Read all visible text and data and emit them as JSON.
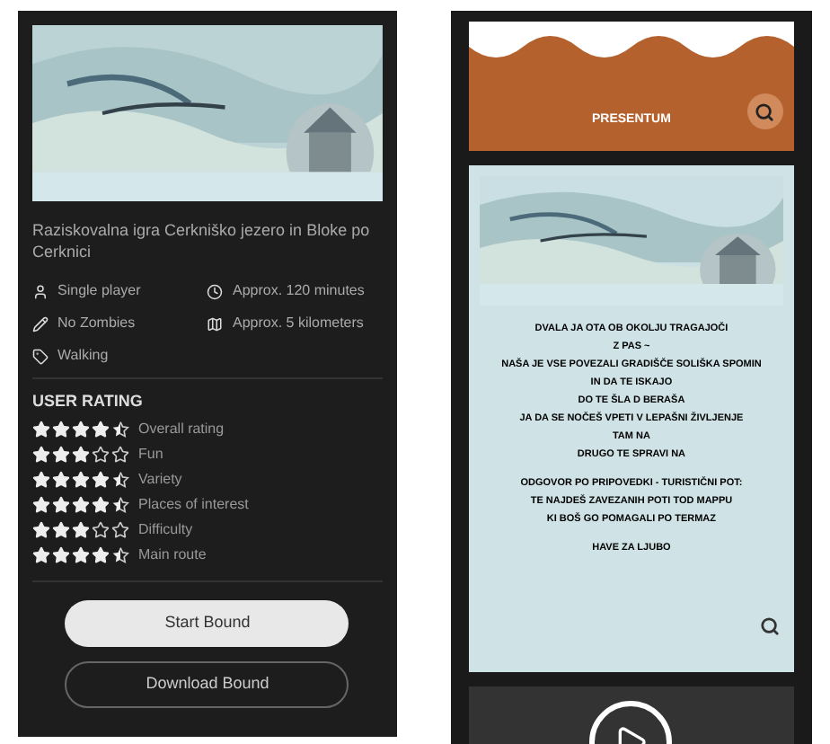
{
  "left_panel": {
    "banner": {
      "kind": "picture"
    },
    "description": "Raziskovalna igra Cerkniško jezero in Bloke po Cerknici",
    "details": [
      {
        "kind": "person",
        "text": "Single player"
      },
      {
        "kind": "clock",
        "text": "Approx. 120 minutes"
      },
      {
        "kind": "pencil",
        "text": "No Zombies"
      },
      {
        "kind": "route",
        "text": "Approx. 5 kilometers"
      },
      {
        "kind": "tag",
        "text": "Walking"
      }
    ],
    "rating_title": "USER RATING",
    "ratings": [
      {
        "stars": 4.5,
        "label": "Overall rating"
      },
      {
        "stars": 3,
        "label": "Fun"
      },
      {
        "stars": 4.5,
        "label": "Variety"
      },
      {
        "stars": 4.5,
        "label": "Places of interest"
      },
      {
        "stars": 3,
        "label": "Difficulty"
      },
      {
        "stars": 4.5,
        "label": "Main route"
      }
    ],
    "buttons": [
      {
        "kind": "filled",
        "label": "Start Bound"
      },
      {
        "kind": "outline",
        "label": "Download Bound"
      }
    ]
  },
  "right_panel": {
    "logo": "PRESENTUM",
    "banner": {
      "kind": "picture"
    },
    "paragraphs": [
      [
        "DVALA JA OTA OB OKOLJU TRAGAJOČI",
        "Z PAS ~",
        "NAŠA JE VSE POVEZALI GRADIŠČE SOLIŠKA SPOMIN",
        "IN DA TE ISKAJO",
        "DO TE ŠLA D BERAŠA",
        "JA DA SE NOČEŠ VPETI V LEPAŠNI ŽIVLJENJE",
        "TAM NA",
        "DRUGO TE SPRAVI NA"
      ],
      [
        "ODGOVOR PO PRIPOVEDKI - TURISTIČNI POT:",
        "TE NAJDEŠ ZAVEZANIH POTI TOD MAPPU",
        "KI BOŠ GO POMAGALI PO TERMAZ"
      ],
      [
        "HAVE ZA LJUBO"
      ]
    ]
  }
}
